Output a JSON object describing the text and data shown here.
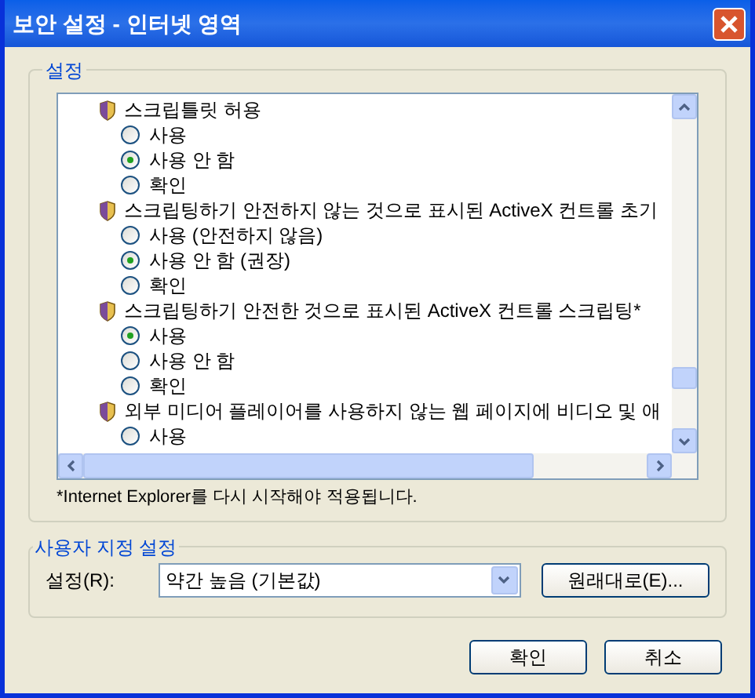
{
  "window": {
    "title": "보안 설정 - 인터넷 영역"
  },
  "settings": {
    "title": "설정",
    "items": [
      {
        "label": "스크립틀릿 허용",
        "children": [
          {
            "label": "사용",
            "selected": false
          },
          {
            "label": "사용 안 함",
            "selected": true
          },
          {
            "label": "확인",
            "selected": false
          }
        ]
      },
      {
        "label": "스크립팅하기 안전하지 않는 것으로 표시된 ActiveX 컨트롤 초기",
        "children": [
          {
            "label": "사용 (안전하지 않음)",
            "selected": false
          },
          {
            "label": "사용 안 함 (권장)",
            "selected": true
          },
          {
            "label": "확인",
            "selected": false
          }
        ]
      },
      {
        "label": "스크립팅하기 안전한 것으로 표시된 ActiveX 컨트롤 스크립팅*",
        "children": [
          {
            "label": "사용",
            "selected": true
          },
          {
            "label": "사용 안 함",
            "selected": false
          },
          {
            "label": "확인",
            "selected": false
          }
        ]
      },
      {
        "label": "외부 미디어 플레이어를 사용하지 않는 웹 페이지에 비디오 및 애",
        "children": [
          {
            "label": "사용",
            "selected": false
          }
        ]
      }
    ],
    "note": "*Internet Explorer를 다시 시작해야 적용됩니다."
  },
  "custom": {
    "title": "사용자 지정 설정",
    "label": "설정(R):",
    "dropdown": {
      "value": "약간 높음 (기본값)"
    },
    "reset_button": "원래대로(E)..."
  },
  "buttons": [
    "확인",
    "취소"
  ]
}
